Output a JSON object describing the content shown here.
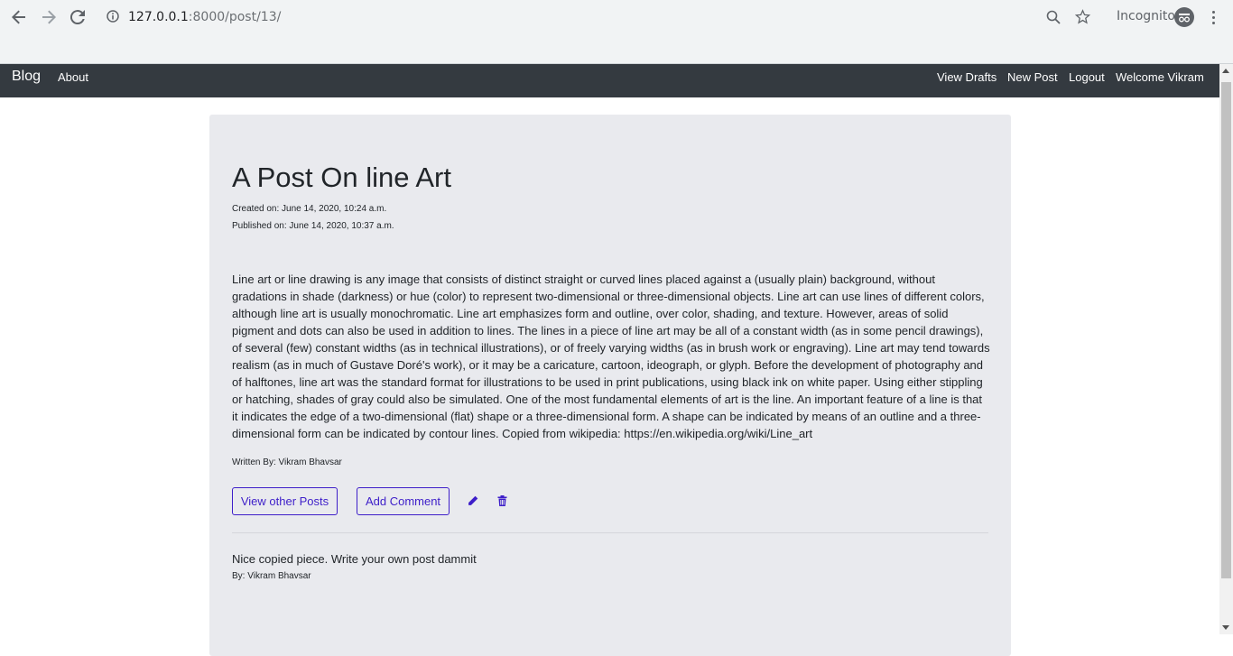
{
  "browser": {
    "url_host": "127.0.0.1",
    "url_rest": ":8000/post/13/",
    "incognito_label": "Incognito",
    "icons": [
      "back-arrow-icon",
      "forward-arrow-icon",
      "reload-icon",
      "info-icon",
      "zoom-icon",
      "star-icon",
      "incognito-icon",
      "kebab-menu-icon"
    ]
  },
  "navbar": {
    "brand": "Blog",
    "about": "About",
    "view_drafts": "View Drafts",
    "new_post": "New Post",
    "logout": "Logout",
    "welcome": "Welcome Vikram"
  },
  "post": {
    "title": "A Post On line Art",
    "created": "Created on: June 14, 2020, 10:24 a.m.",
    "published": "Published on: June 14, 2020, 10:37 a.m.",
    "body": "Line art or line drawing is any image that consists of distinct straight or curved lines placed against a (usually plain) background, without gradations in shade (darkness) or hue (color) to represent two-dimensional or three-dimensional objects. Line art can use lines of different colors, although line art is usually monochromatic. Line art emphasizes form and outline, over color, shading, and texture. However, areas of solid pigment and dots can also be used in addition to lines. The lines in a piece of line art may be all of a constant width (as in some pencil drawings), of several (few) constant widths (as in technical illustrations), or of freely varying widths (as in brush work or engraving). Line art may tend towards realism (as in much of Gustave Doré's work), or it may be a caricature, cartoon, ideograph, or glyph. Before the development of photography and of halftones, line art was the standard format for illustrations to be used in print publications, using black ink on white paper. Using either stippling or hatching, shades of gray could also be simulated. One of the most fundamental elements of art is the line. An important feature of a line is that it indicates the edge of a two-dimensional (flat) shape or a three-dimensional form. A shape can be indicated by means of an outline and a three-dimensional form can be indicated by contour lines. Copied from wikipedia: https://en.wikipedia.org/wiki/Line_art",
    "author": "Written By: Vikram Bhavsar"
  },
  "actions": {
    "view_other_posts": "View other Posts",
    "add_comment": "Add Comment",
    "accent_color": "#3d1ec9"
  },
  "comments": [
    {
      "text": "Nice copied piece. Write your own post dammit",
      "by": "By: Vikram Bhavsar"
    }
  ]
}
